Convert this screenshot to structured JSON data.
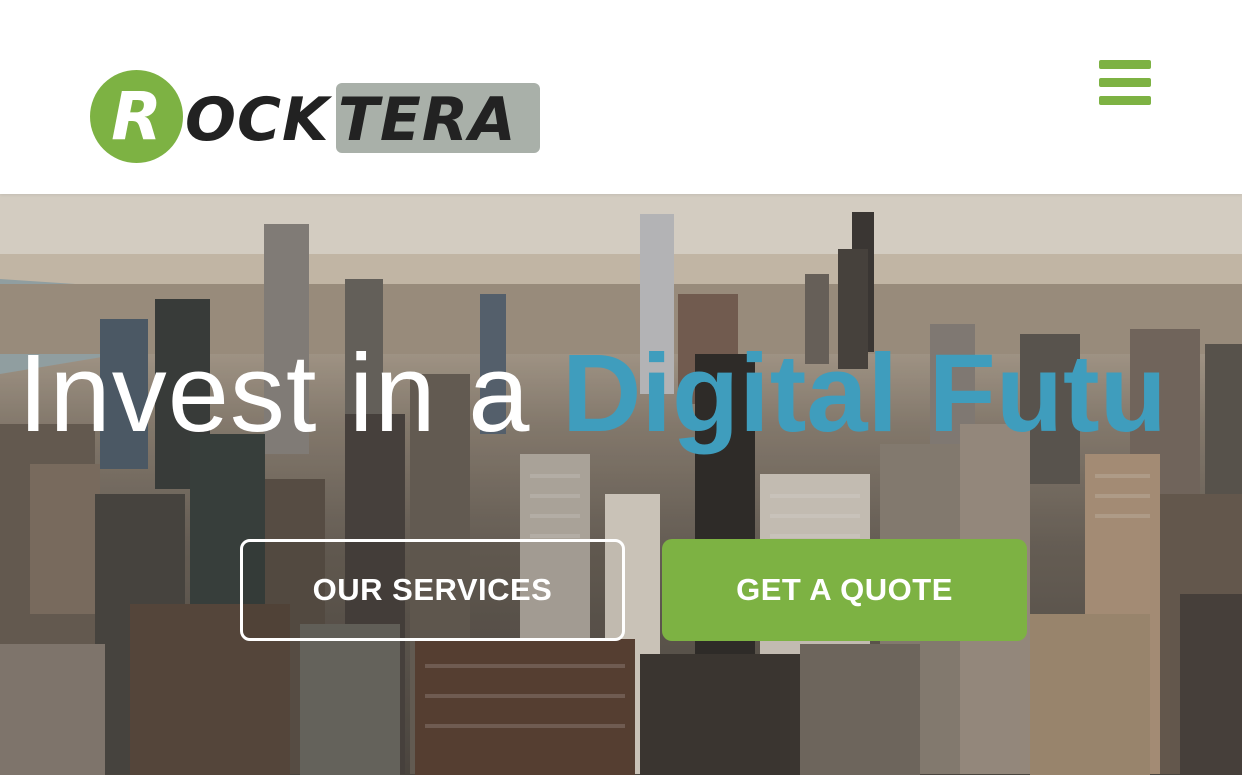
{
  "header": {
    "logo": {
      "letter": "R",
      "part1": "OCK",
      "part2": "TERA",
      "colors": {
        "green": "#7db243",
        "dark": "#222222",
        "box": "#a9b0a9"
      }
    },
    "menu_icon": "hamburger-menu-icon"
  },
  "hero": {
    "headline_light": "Invest in a ",
    "headline_accent": "Digital Futu",
    "accent_color": "#3f9dbd",
    "buttons": {
      "services_label": "OUR SERVICES",
      "quote_label": "GET A QUOTE"
    },
    "button_color": "#7db243"
  }
}
